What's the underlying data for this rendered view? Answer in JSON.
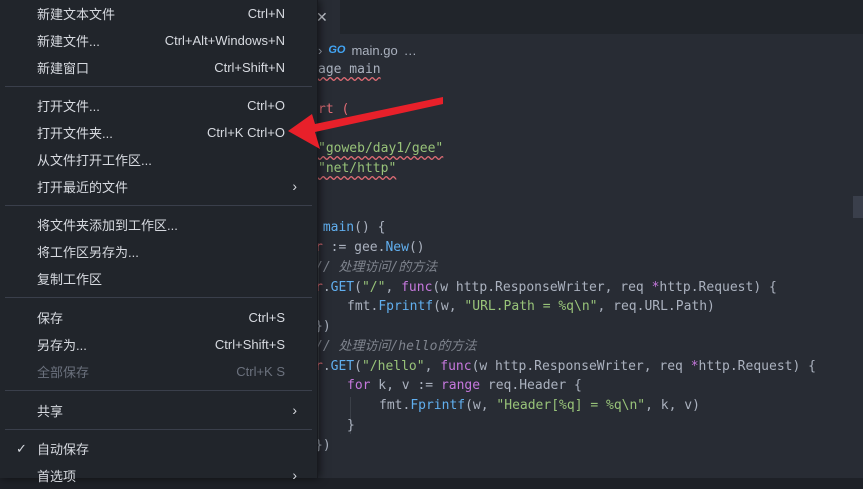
{
  "editor": {
    "tab_close": "✕",
    "breadcrumb": {
      "chevron": "›",
      "go_badge": "GO",
      "file": "main.go",
      "more": "…"
    },
    "code_lines": [
      {
        "tokens": [
          {
            "t": "age main",
            "c": "pl sq"
          }
        ]
      },
      {
        "tokens": [
          {
            "t": "rt (",
            "c": "var"
          }
        ]
      },
      {
        "tokens": [
          {
            "t": "\"goweb/day1/gee\"",
            "c": "str sq"
          }
        ]
      },
      {
        "tokens": [
          {
            "t": "\"net/http\"",
            "c": "str sq"
          }
        ]
      },
      {
        "tokens": [
          {
            "t": " main",
            "c": "fn"
          },
          {
            "t": "() {",
            "c": "pl"
          }
        ]
      },
      {
        "tokens": [
          {
            "t": "r",
            "c": "var"
          },
          {
            "t": " := gee.",
            "c": "pl"
          },
          {
            "t": "New",
            "c": "fn"
          },
          {
            "t": "()",
            "c": "pl"
          }
        ]
      },
      {
        "tokens": [
          {
            "t": "// 处理访问/的方法",
            "c": "cm"
          }
        ]
      },
      {
        "tokens": [
          {
            "t": "r",
            "c": "var"
          },
          {
            "t": ".",
            "c": "pl"
          },
          {
            "t": "GET",
            "c": "fn"
          },
          {
            "t": "(",
            "c": "pl"
          },
          {
            "t": "\"/\"",
            "c": "str"
          },
          {
            "t": ", ",
            "c": "pl"
          },
          {
            "t": "func",
            "c": "kw"
          },
          {
            "t": "(w http.ResponseWriter, req ",
            "c": "pl"
          },
          {
            "t": "*",
            "c": "kw"
          },
          {
            "t": "http.Request) {",
            "c": "pl"
          }
        ]
      },
      {
        "tokens": [
          {
            "t": "fmt.",
            "c": "pl"
          },
          {
            "t": "Fprintf",
            "c": "fn"
          },
          {
            "t": "(w, ",
            "c": "pl"
          },
          {
            "t": "\"URL.Path = %q\\n\"",
            "c": "str"
          },
          {
            "t": ", req.URL.Path)",
            "c": "pl"
          }
        ]
      },
      {
        "tokens": [
          {
            "t": "})",
            "c": "pl"
          }
        ]
      },
      {
        "tokens": [
          {
            "t": "// 处理访问/hello的方法",
            "c": "cm"
          }
        ]
      },
      {
        "tokens": [
          {
            "t": "r",
            "c": "var"
          },
          {
            "t": ".",
            "c": "pl"
          },
          {
            "t": "GET",
            "c": "fn"
          },
          {
            "t": "(",
            "c": "pl"
          },
          {
            "t": "\"/hello\"",
            "c": "str"
          },
          {
            "t": ", ",
            "c": "pl"
          },
          {
            "t": "func",
            "c": "kw"
          },
          {
            "t": "(w http.ResponseWriter, req ",
            "c": "pl"
          },
          {
            "t": "*",
            "c": "kw"
          },
          {
            "t": "http.Request) {",
            "c": "pl"
          }
        ]
      },
      {
        "tokens": [
          {
            "t": "for",
            "c": "kw"
          },
          {
            "t": " k, v := ",
            "c": "pl"
          },
          {
            "t": "range",
            "c": "kw"
          },
          {
            "t": " req.Header {",
            "c": "pl"
          }
        ]
      },
      {
        "tokens": [
          {
            "t": "fmt.",
            "c": "pl"
          },
          {
            "t": "Fprintf",
            "c": "fn"
          },
          {
            "t": "(w, ",
            "c": "pl"
          },
          {
            "t": "\"Header[%q] = %q\\n\"",
            "c": "str"
          },
          {
            "t": ", k, v)",
            "c": "pl"
          }
        ]
      },
      {
        "tokens": [
          {
            "t": "}",
            "c": "pl"
          }
        ]
      },
      {
        "tokens": [
          {
            "t": "})",
            "c": "pl"
          }
        ]
      }
    ]
  },
  "menu": {
    "items": [
      {
        "label": "新建文本文件",
        "key": "Ctrl+N"
      },
      {
        "label": "新建文件...",
        "key": "Ctrl+Alt+Windows+N"
      },
      {
        "label": "新建窗口",
        "key": "Ctrl+Shift+N"
      },
      {
        "label": "打开文件...",
        "key": "Ctrl+O"
      },
      {
        "label": "打开文件夹...",
        "key": "Ctrl+K Ctrl+O"
      },
      {
        "label": "从文件打开工作区...",
        "key": ""
      },
      {
        "label": "打开最近的文件",
        "key": ""
      },
      {
        "label": "将文件夹添加到工作区...",
        "key": ""
      },
      {
        "label": "将工作区另存为...",
        "key": ""
      },
      {
        "label": "复制工作区",
        "key": ""
      },
      {
        "label": "保存",
        "key": "Ctrl+S"
      },
      {
        "label": "另存为...",
        "key": "Ctrl+Shift+S"
      },
      {
        "label": "全部保存",
        "key": "Ctrl+K S"
      },
      {
        "label": "共享",
        "key": ""
      },
      {
        "label": "自动保存",
        "key": ""
      },
      {
        "label": "首选项",
        "key": ""
      }
    ],
    "chevron": "›",
    "check": "✓"
  },
  "colors": {
    "annotation_arrow": "#e8202a"
  }
}
